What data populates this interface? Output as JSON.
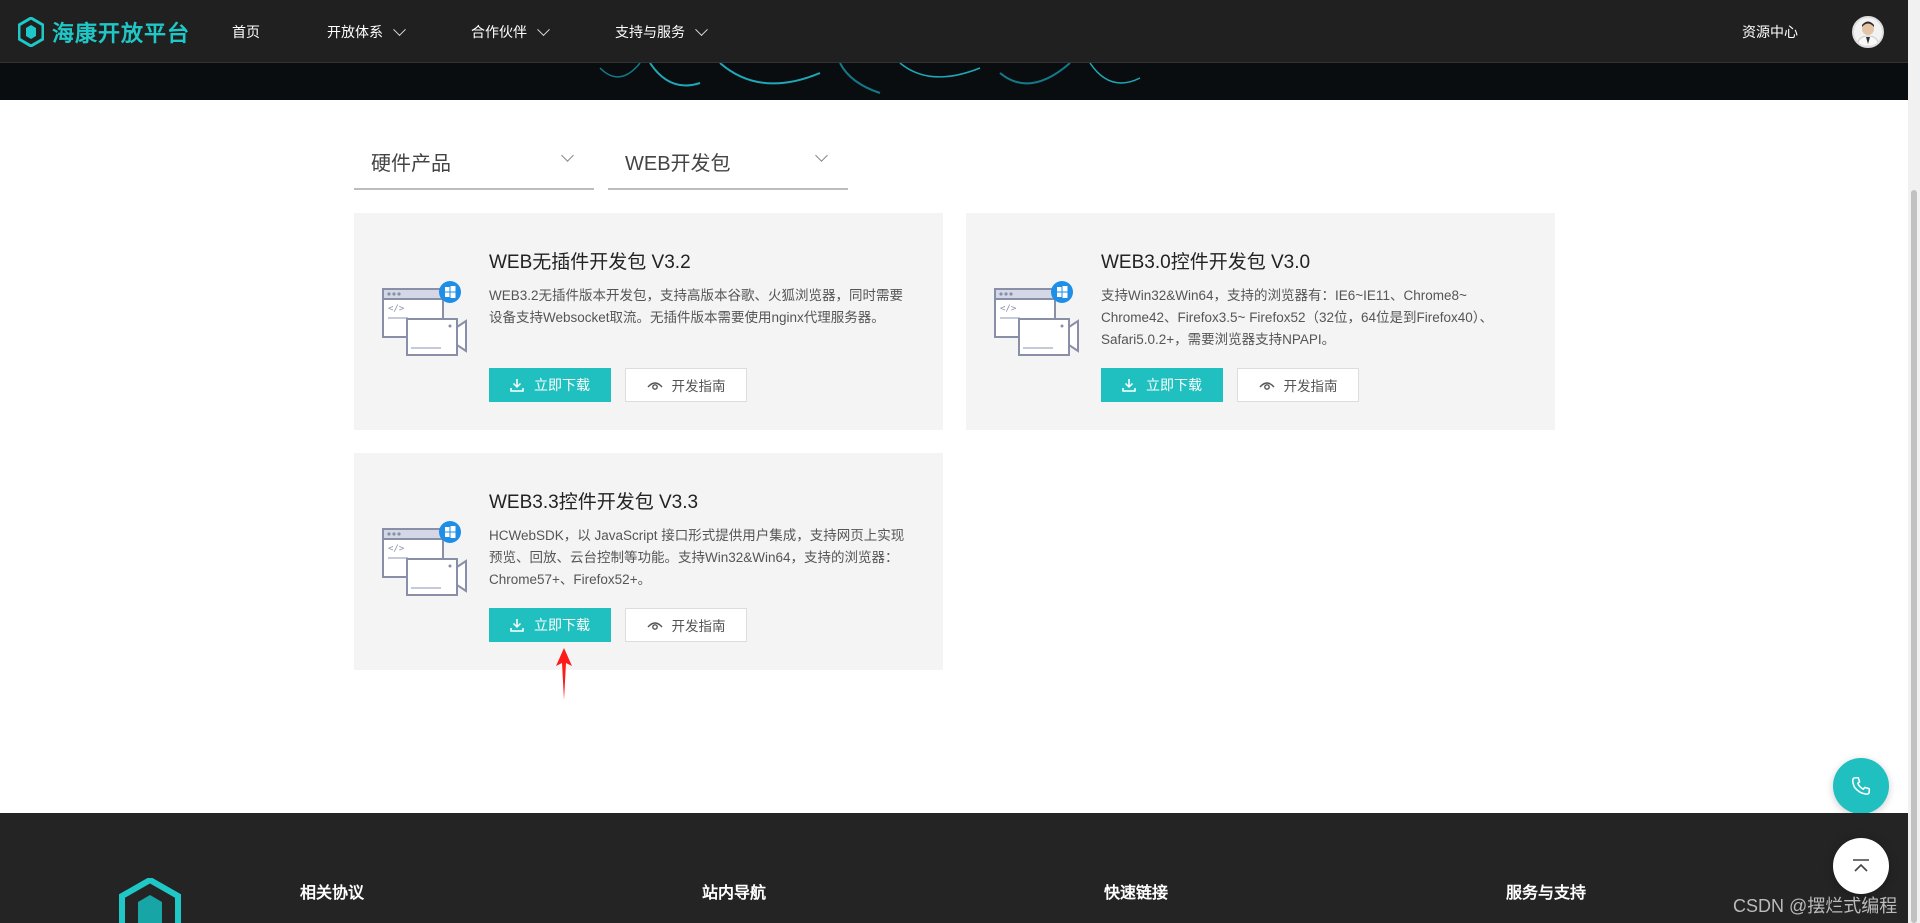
{
  "nav": {
    "brand": "海康开放平台",
    "items": [
      {
        "label": "首页",
        "has_dropdown": false
      },
      {
        "label": "开放体系",
        "has_dropdown": true
      },
      {
        "label": "合作伙伴",
        "has_dropdown": true
      },
      {
        "label": "支持与服务",
        "has_dropdown": true
      }
    ],
    "resource_center": "资源中心"
  },
  "filters": {
    "category": "硬件产品",
    "subcategory": "WEB开发包"
  },
  "cards": [
    {
      "title": "WEB无插件开发包 V3.2",
      "desc": "WEB3.2无插件版本开发包，支持高版本谷歌、火狐浏览器，同时需要设备支持Websocket取流。无插件版本需要使用nginx代理服务器。",
      "download_label": "立即下载",
      "guide_label": "开发指南"
    },
    {
      "title": "WEB3.0控件开发包 V3.0",
      "desc": "支持Win32&Win64，支持的浏览器有：IE6~IE11、Chrome8~ Chrome42、Firefox3.5~ Firefox52（32位，64位是到Firefox40）、Safari5.0.2+，需要浏览器支持NPAPI。",
      "download_label": "立即下载",
      "guide_label": "开发指南"
    },
    {
      "title": "WEB3.3控件开发包 V3.3",
      "desc": "HCWebSDK，以 JavaScript 接口形式提供用户集成，支持网页上实现预览、回放、云台控制等功能。支持Win32&Win64，支持的浏览器：Chrome57+、Firefox52+。",
      "download_label": "立即下载",
      "guide_label": "开发指南"
    }
  ],
  "footer": {
    "columns": [
      "相关协议",
      "站内导航",
      "快速链接",
      "服务与支持"
    ]
  },
  "watermark": "CSDN @摆烂式编程",
  "colors": {
    "accent": "#1fc0bf",
    "nav_bg": "#202020",
    "card_bg": "#f4f4f4",
    "annotation": "#ff0000"
  },
  "icons": [
    "logo-icon",
    "chevron-down-icon",
    "avatar",
    "download-icon",
    "eye-icon",
    "sdk-window-icon",
    "phone-icon",
    "arrow-up-icon"
  ]
}
